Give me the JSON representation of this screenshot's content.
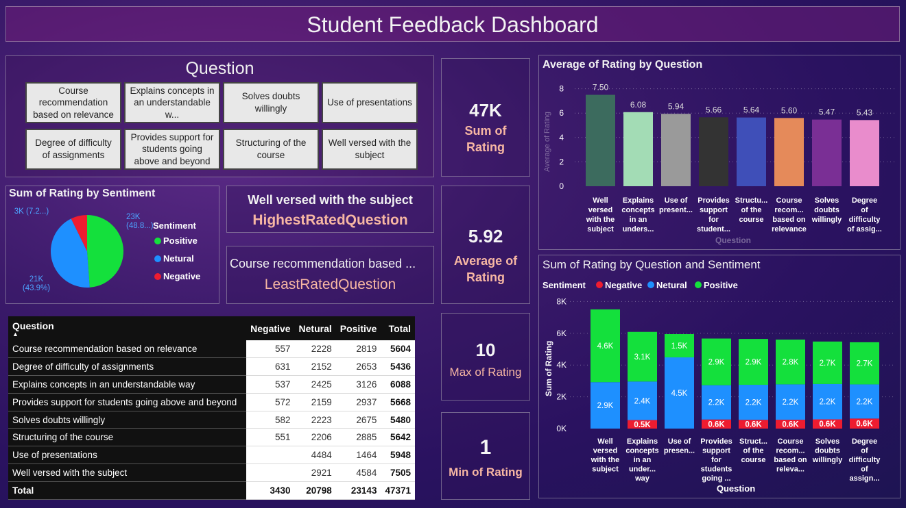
{
  "header": {
    "title": "Student Feedback Dashboard"
  },
  "question_slicer": {
    "title": "Question",
    "items": [
      "Course recommendation based on relevance",
      "Explains concepts in an understandable w...",
      "Solves doubts willingly",
      "Use of presentations",
      "Degree of difficulty of assignments",
      "Provides support for students going above and beyond",
      "Structuring of the course",
      "Well versed with the subject"
    ]
  },
  "cards": {
    "highest_value": "Well versed with the subject",
    "highest_label": "HighestRatedQuestion",
    "least_value": "Course recommendation based ...",
    "least_label": "LeastRatedQuestion"
  },
  "kpis": [
    {
      "value": "47K",
      "label": "Sum of Rating"
    },
    {
      "value": "5.92",
      "label": "Average of Rating"
    },
    {
      "value": "10",
      "label": "Max of Rating"
    },
    {
      "value": "1",
      "label": "Min of Rating"
    }
  ],
  "colors": {
    "positive": "#14e03c",
    "neutral": "#1e90ff",
    "negative": "#ee1c30",
    "avg_bars": [
      "#3c6b5e",
      "#a3dcb5",
      "#9a9a9a",
      "#333333",
      "#3f4fb8",
      "#e58a5a",
      "#7a2f95",
      "#e98ccc"
    ]
  },
  "table": {
    "headers": [
      "Question",
      "Negative",
      "Netural",
      "Positive",
      "Total"
    ],
    "rows": [
      [
        "Course recommendation based on relevance",
        "557",
        "2228",
        "2819",
        "5604"
      ],
      [
        "Degree of difficulty of assignments",
        "631",
        "2152",
        "2653",
        "5436"
      ],
      [
        "Explains concepts in an understandable way",
        "537",
        "2425",
        "3126",
        "6088"
      ],
      [
        "Provides support for students going above and beyond",
        "572",
        "2159",
        "2937",
        "5668"
      ],
      [
        "Solves doubts willingly",
        "582",
        "2223",
        "2675",
        "5480"
      ],
      [
        "Structuring of the course",
        "551",
        "2206",
        "2885",
        "5642"
      ],
      [
        "Use of presentations",
        "",
        "4484",
        "1464",
        "5948"
      ],
      [
        "Well versed with the subject",
        "",
        "2921",
        "4584",
        "7505"
      ]
    ],
    "total": [
      "Total",
      "3430",
      "20798",
      "23143",
      "47371"
    ]
  },
  "chart_data": [
    {
      "type": "pie",
      "title": "Sum of Rating by Sentiment",
      "legend_title": "Sentiment",
      "labels": [
        "Positive",
        "Netural",
        "Negative"
      ],
      "values": [
        23143,
        20798,
        3430
      ],
      "data_labels": [
        {
          "value": "23K",
          "pct": "(48.8...)"
        },
        {
          "value": "21K",
          "pct": "(43.9%)"
        },
        {
          "value": "3K",
          "pct": "(7.2...)"
        }
      ]
    },
    {
      "type": "bar",
      "title": "Average of Rating by Question",
      "xlabel": "Question",
      "ylabel": "Average of Rating",
      "ylim": [
        0,
        8
      ],
      "yticks": [
        "0",
        "2",
        "4",
        "6",
        "8"
      ],
      "categories": [
        [
          "Well",
          "versed",
          "with the",
          "subject"
        ],
        [
          "Explains",
          "concepts",
          "in an",
          "unders..."
        ],
        [
          "Use of",
          "present..."
        ],
        [
          "Provides",
          "support",
          "for",
          "student..."
        ],
        [
          "Structu...",
          "of the",
          "course"
        ],
        [
          "Course",
          "recom...",
          "based on",
          "relevance"
        ],
        [
          "Solves",
          "doubts",
          "willingly"
        ],
        [
          "Degree",
          "of",
          "difficulty",
          "of assig..."
        ]
      ],
      "values": [
        7.5,
        6.08,
        5.94,
        5.66,
        5.64,
        5.6,
        5.47,
        5.43
      ],
      "data_labels": [
        "7.50",
        "6.08",
        "5.94",
        "5.66",
        "5.64",
        "5.60",
        "5.47",
        "5.43"
      ]
    },
    {
      "type": "bar",
      "stacked": true,
      "title": "Sum of Rating by Question and Sentiment",
      "legend_title": "Sentiment",
      "xlabel": "Question",
      "ylabel": "Sum of Rating",
      "ylim": [
        0,
        8000
      ],
      "yticks": [
        "0K",
        "2K",
        "4K",
        "6K",
        "8K"
      ],
      "categories": [
        [
          "Well",
          "versed",
          "with the",
          "subject"
        ],
        [
          "Explains",
          "concepts",
          "in an",
          "under...",
          "way"
        ],
        [
          "Use of",
          "presen..."
        ],
        [
          "Provides",
          "support",
          "for",
          "students",
          "going ..."
        ],
        [
          "Struct...",
          "of the",
          "course"
        ],
        [
          "Course",
          "recom...",
          "based on",
          "releva..."
        ],
        [
          "Solves",
          "doubts",
          "willingly"
        ],
        [
          "Degree",
          "of",
          "difficulty",
          "of",
          "assign..."
        ]
      ],
      "series": [
        {
          "name": "Negative",
          "values": [
            0,
            537,
            0,
            572,
            551,
            557,
            582,
            631
          ],
          "labels": [
            "",
            "0.5K",
            "",
            "0.6K",
            "0.6K",
            "0.6K",
            "0.6K",
            "0.6K"
          ]
        },
        {
          "name": "Netural",
          "values": [
            2921,
            2425,
            4484,
            2159,
            2206,
            2228,
            2223,
            2152
          ],
          "labels": [
            "2.9K",
            "2.4K",
            "4.5K",
            "2.2K",
            "2.2K",
            "2.2K",
            "2.2K",
            "2.2K"
          ]
        },
        {
          "name": "Positive",
          "values": [
            4584,
            3126,
            1464,
            2937,
            2885,
            2819,
            2675,
            2653
          ],
          "labels": [
            "4.6K",
            "3.1K",
            "1.5K",
            "2.9K",
            "2.9K",
            "2.8K",
            "2.7K",
            "2.7K"
          ]
        }
      ]
    }
  ]
}
